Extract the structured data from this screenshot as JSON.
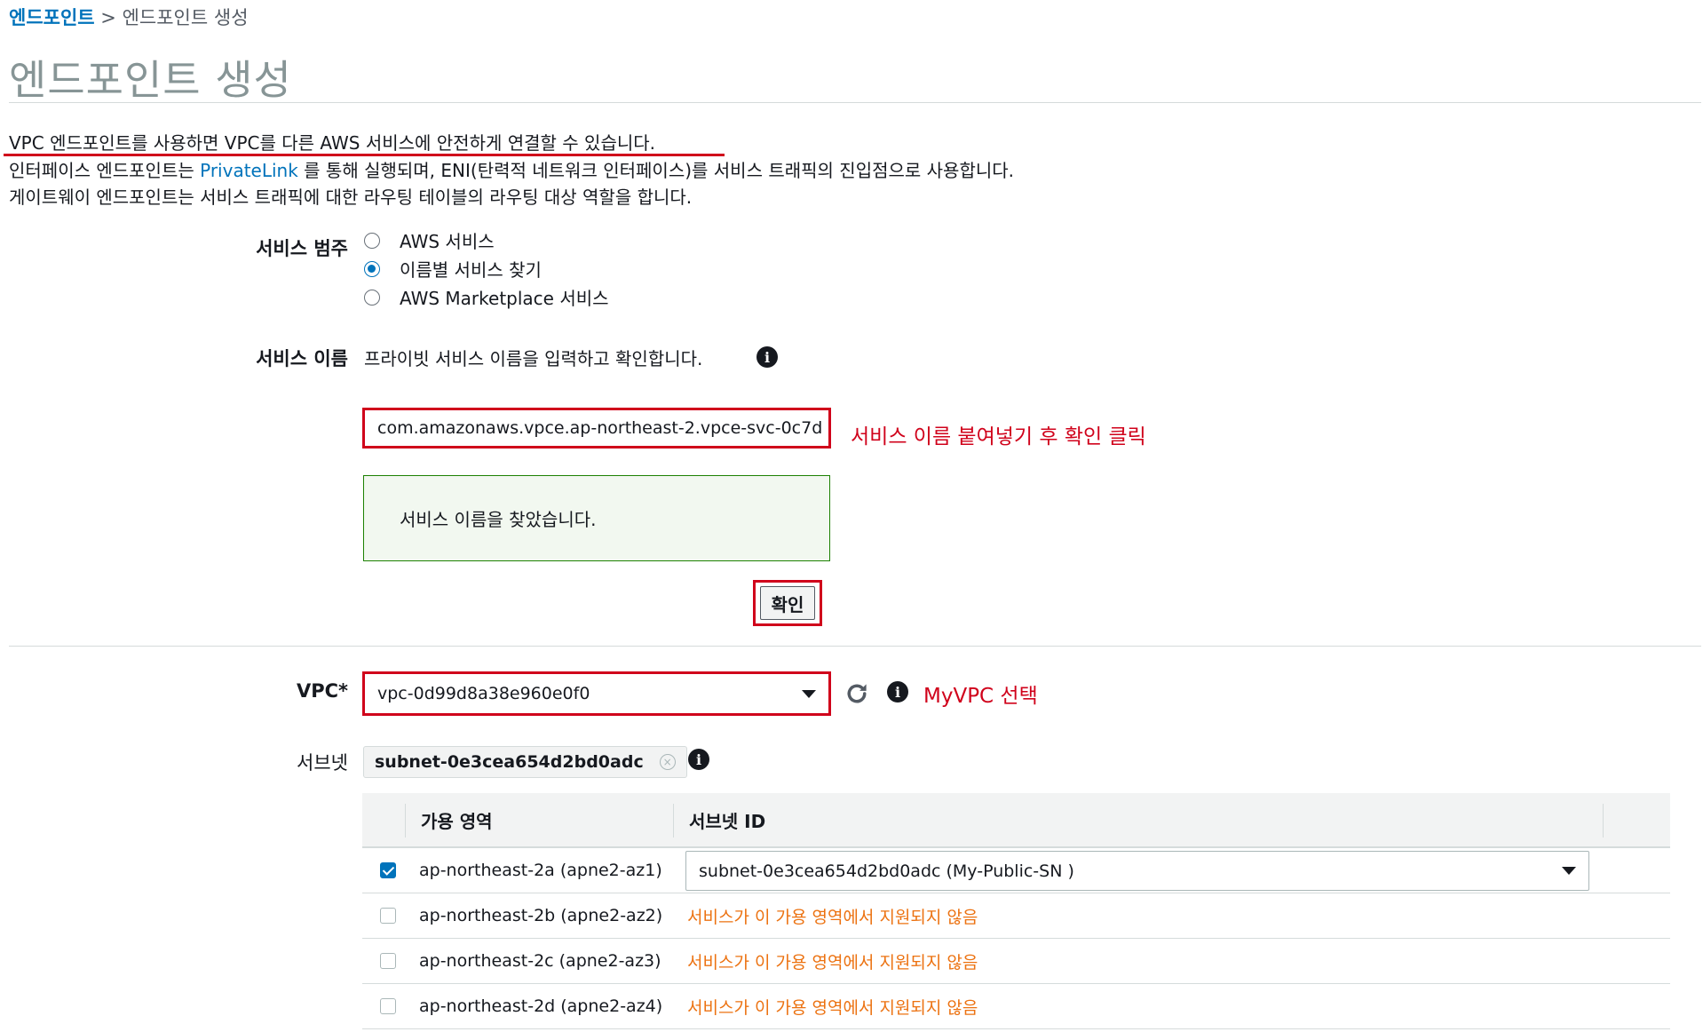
{
  "breadcrumb": {
    "parent": "엔드포인트",
    "separator": ">",
    "current": "엔드포인트 생성"
  },
  "page": {
    "title": "엔드포인트 생성"
  },
  "intro": {
    "line1": "VPC 엔드포인트를 사용하면 VPC를 다른 AWS 서비스에 안전하게 연결할 수 있습니다.",
    "line2_prefix": "인터페이스 엔드포인트는 ",
    "line2_link": "PrivateLink",
    "line2_suffix": " 를 통해 실행되며, ENI(탄력적 네트워크 인터페이스)를 서비스 트래픽의 진입점으로 사용합니다.",
    "line3": "게이트웨이 엔드포인트는 서비스 트래픽에 대한 라우팅 테이블의 라우팅 대상 역할을 합니다."
  },
  "service_category": {
    "label": "서비스 범주",
    "options": [
      {
        "label": "AWS 서비스",
        "selected": false
      },
      {
        "label": "이름별 서비스 찾기",
        "selected": true
      },
      {
        "label": "AWS Marketplace 서비스",
        "selected": false
      }
    ]
  },
  "service_name": {
    "label": "서비스 이름",
    "hint": "프라이빗 서비스 이름을 입력하고 확인합니다.",
    "value": "com.amazonaws.vpce.ap-northeast-2.vpce-svc-0c7d",
    "annotation": "서비스 이름 붙여넣기 후 확인 클릭",
    "success_message": "서비스 이름을 찾았습니다.",
    "confirm_label": "확인"
  },
  "vpc": {
    "label": "VPC*",
    "value": "vpc-0d99d8a38e960e0f0",
    "annotation": "MyVPC 선택"
  },
  "subnet": {
    "label": "서브넷",
    "token": "subnet-0e3cea654d2bd0adc",
    "token_remove": "×",
    "table": {
      "headers": {
        "az": "가용 영역",
        "subnet_id": "서브넷 ID"
      },
      "rows": [
        {
          "az": "ap-northeast-2a (apne2-az1)",
          "checked": true,
          "subnet": "subnet-0e3cea654d2bd0adc (My-Public-SN )"
        },
        {
          "az": "ap-northeast-2b (apne2-az2)",
          "checked": false,
          "subnet": "서비스가 이 가용 영역에서 지원되지 않음"
        },
        {
          "az": "ap-northeast-2c (apne2-az3)",
          "checked": false,
          "subnet": "서비스가 이 가용 영역에서 지원되지 않음"
        },
        {
          "az": "ap-northeast-2d (apne2-az4)",
          "checked": false,
          "subnet": "서비스가 이 가용 영역에서 지원되지 않음"
        }
      ]
    }
  },
  "icons": {
    "info": "i"
  },
  "colors": {
    "link": "#0073bb",
    "annotation_red": "#d0021b",
    "success_border": "#1d8102",
    "warning_orange": "#ec7211"
  }
}
